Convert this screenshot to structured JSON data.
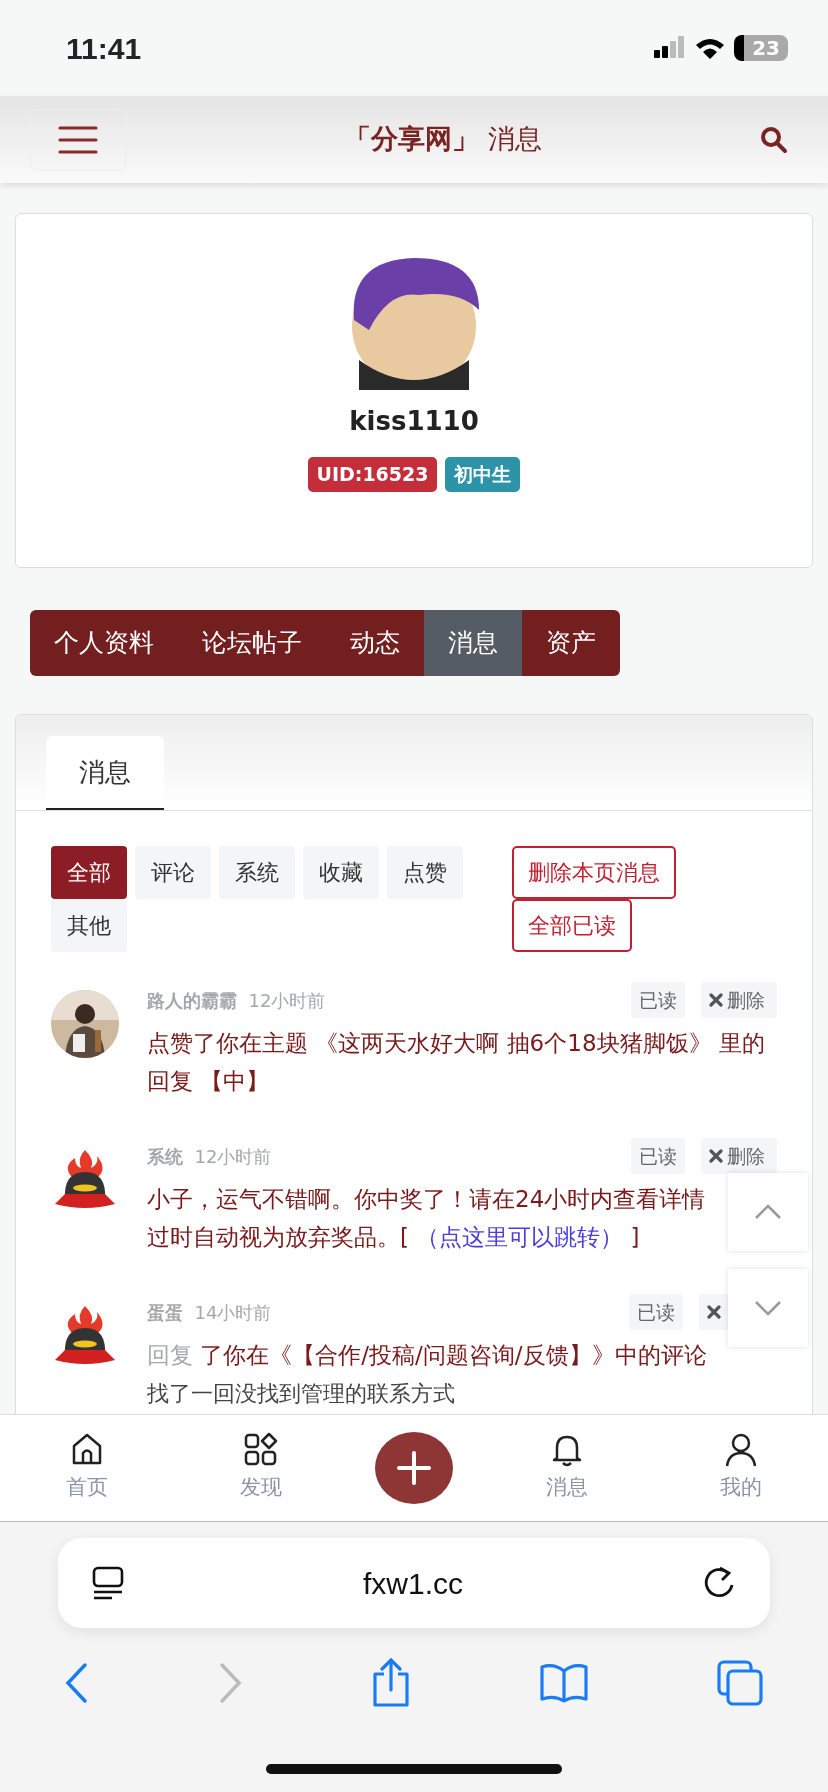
{
  "status_bar": {
    "time": "11:41",
    "battery": "23"
  },
  "header": {
    "site": "「分享网」",
    "title": "消息"
  },
  "profile": {
    "username": "kiss1110",
    "badges": [
      {
        "text": "UID:16523",
        "kind": "danger"
      },
      {
        "text": "初中生",
        "kind": "info"
      }
    ]
  },
  "nav_tabs": [
    {
      "label": "个人资料",
      "selected": false
    },
    {
      "label": "论坛帖子",
      "selected": false
    },
    {
      "label": "动态",
      "selected": false
    },
    {
      "label": "消息",
      "selected": true
    },
    {
      "label": "资产",
      "selected": false
    }
  ],
  "panel": {
    "tabs": [
      {
        "label": "消息",
        "selected": true
      }
    ],
    "filters": [
      {
        "label": "全部",
        "selected": true
      },
      {
        "label": "评论",
        "selected": false
      },
      {
        "label": "系统",
        "selected": false
      },
      {
        "label": "收藏",
        "selected": false
      },
      {
        "label": "点赞",
        "selected": false
      },
      {
        "label": "其他",
        "selected": false
      }
    ],
    "actions": [
      "删除本页消息",
      "全部已读"
    ],
    "messages": [
      {
        "sender": "路人的霸霸",
        "time": "12小时前",
        "kind": "picture",
        "read_label": "已读",
        "delete_label": "删除",
        "parts": [
          {
            "kind": "text",
            "text": "点赞了你在主题 《这两天水好大啊 抽6个18块猪脚饭》 里的回复 【中】"
          }
        ]
      },
      {
        "sender": "系统",
        "time": "12小时前",
        "kind": "icon",
        "read_label": "已读",
        "delete_label": "删除",
        "parts": [
          {
            "kind": "text",
            "text": "小子，运气不错啊。你中奖了！请在24小时内查看详情"
          },
          {
            "kind": "break"
          },
          {
            "kind": "text",
            "text": "过时自动视为放弃奖品。[ "
          },
          {
            "kind": "link",
            "text": "（点这里可以跳转）"
          },
          {
            "kind": "text",
            "text": " ]"
          }
        ]
      },
      {
        "sender": "蛋蛋",
        "time": "14小时前",
        "kind": "icon",
        "read_label": "已读",
        "parts": [
          {
            "kind": "muted",
            "text": "回复"
          },
          {
            "kind": "text",
            "text": " 了你在《【合作/投稿/问题咨询/反馈】》中的评论"
          }
        ],
        "quote": "找了一回没找到管理的联系方式"
      }
    ]
  },
  "bottom_nav": [
    {
      "label": "首页",
      "kind": "tab"
    },
    {
      "label": "发现",
      "kind": "tab"
    },
    {
      "kind": "plus"
    },
    {
      "label": "消息",
      "kind": "tab"
    },
    {
      "label": "我的",
      "kind": "tab"
    }
  ],
  "browser": {
    "url": "fxw1.cc"
  }
}
